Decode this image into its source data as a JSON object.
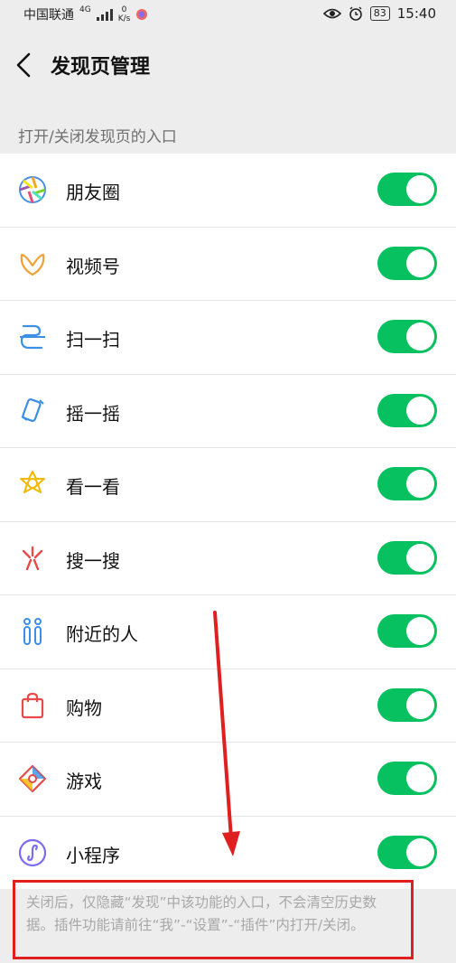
{
  "status_bar": {
    "carrier": "中国联通",
    "network": "4G",
    "speed_value": "0",
    "speed_unit": "K/s",
    "battery": "83",
    "time": "15:40"
  },
  "nav": {
    "title": "发现页管理"
  },
  "section_label": "打开/关闭发现页的入口",
  "items": [
    {
      "label": "朋友圈",
      "icon": "moments-icon",
      "on": true
    },
    {
      "label": "视频号",
      "icon": "channels-icon",
      "on": true
    },
    {
      "label": "扫一扫",
      "icon": "scan-icon",
      "on": true
    },
    {
      "label": "摇一摇",
      "icon": "shake-icon",
      "on": true
    },
    {
      "label": "看一看",
      "icon": "top-stories-icon",
      "on": true
    },
    {
      "label": "搜一搜",
      "icon": "search-icon",
      "on": true
    },
    {
      "label": "附近的人",
      "icon": "people-nearby-icon",
      "on": true
    },
    {
      "label": "购物",
      "icon": "shopping-icon",
      "on": true
    },
    {
      "label": "游戏",
      "icon": "games-icon",
      "on": true
    },
    {
      "label": "小程序",
      "icon": "mini-programs-icon",
      "on": true
    }
  ],
  "footer_note": "关闭后，仅隐藏“发现”中该功能的入口，不会清空历史数据。插件功能请前往“我”-“设置”-“插件”内打开/关闭。",
  "colors": {
    "toggle_on": "#07c160",
    "annotation": "#e02020"
  }
}
